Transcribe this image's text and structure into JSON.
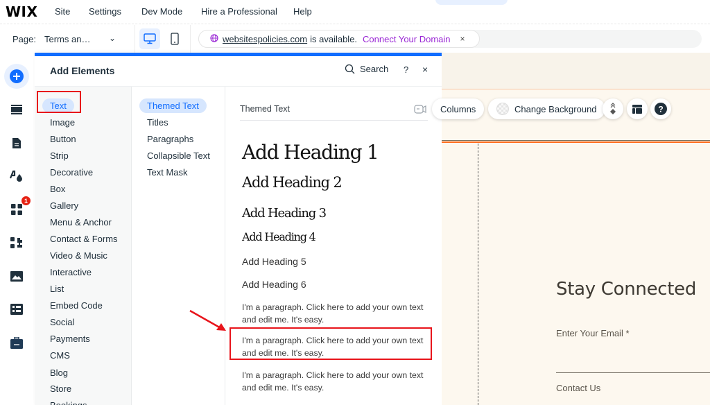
{
  "topbar": {
    "logo": "WIX",
    "menu": [
      "Site",
      "Settings",
      "Dev Mode",
      "Hire a Professional",
      "Help"
    ],
    "collapse_glyph": "⌃"
  },
  "toolbar": {
    "page_label": "Page:",
    "page_value": "Terms an…",
    "page_chevron": "⌄",
    "devices": [
      {
        "name": "desktop",
        "icon": "desktop-icon",
        "active": true
      },
      {
        "name": "mobile",
        "icon": "mobile-icon",
        "active": false
      }
    ],
    "domain": {
      "url": "websitespolicies.com",
      "message": "is available.",
      "connect_label": "Connect Your Domain",
      "close_glyph": "×",
      "accent": "#9a27d5"
    }
  },
  "rail": {
    "items": [
      {
        "icon": "add-icon",
        "active": true
      },
      {
        "icon": "sections-icon"
      },
      {
        "icon": "pages-icon"
      },
      {
        "icon": "design-icon"
      },
      {
        "icon": "apps-icon",
        "badge": "1"
      },
      {
        "icon": "business-apps-icon"
      },
      {
        "icon": "media-icon"
      },
      {
        "icon": "cms-icon"
      },
      {
        "icon": "portfolio-icon"
      }
    ]
  },
  "panel": {
    "title": "Add Elements",
    "search_label": "Search",
    "help_glyph": "?",
    "close_glyph": "×",
    "categories": [
      "Text",
      "Image",
      "Button",
      "Strip",
      "Decorative",
      "Box",
      "Gallery",
      "Menu & Anchor",
      "Contact & Forms",
      "Video & Music",
      "Interactive",
      "List",
      "Embed Code",
      "Social",
      "Payments",
      "CMS",
      "Blog",
      "Store",
      "Bookings"
    ],
    "selected_category": "Text",
    "subcategories": [
      "Themed Text",
      "Titles",
      "Paragraphs",
      "Collapsible Text",
      "Text Mask"
    ],
    "selected_subcategory": "Themed Text",
    "content": {
      "heading": "Themed Text",
      "headings": [
        "Add Heading 1",
        "Add Heading 2",
        "Add Heading 3",
        "Add Heading 4",
        "Add Heading 5",
        "Add Heading 6"
      ],
      "paragraphs": [
        "I'm a paragraph. Click here to add your own text and edit me. It's easy.",
        "I'm a paragraph. Click here to add your own text and edit me. It's easy.",
        "I'm a paragraph. Click here to add your own text and edit me. It's easy."
      ]
    },
    "accent": "#116dff"
  },
  "canvas": {
    "controls": {
      "columns_label": "Columns",
      "change_background_label": "Change Background"
    },
    "stay_connected": "Stay Connected",
    "email_label": "Enter Your Email *",
    "contact_label": "Contact Us"
  },
  "annotations": {
    "highlight_color": "#e8141b"
  }
}
